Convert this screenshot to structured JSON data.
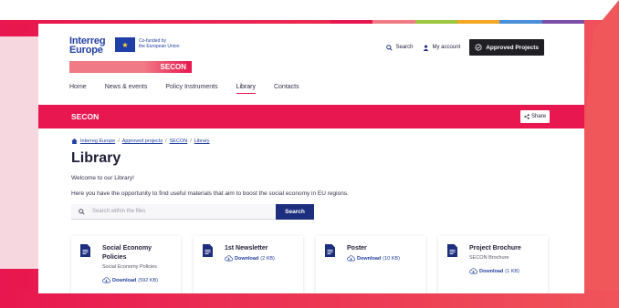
{
  "colors": {
    "brand_red": "#e8174f",
    "navy": "#1d2e7e",
    "link_blue": "#2340a0",
    "strip": [
      "#e8174f",
      "#f07b86",
      "#9bc53d",
      "#f5a623",
      "#4a90d9",
      "#7b4fa8"
    ]
  },
  "logo": {
    "name_line1": "Interreg",
    "name_line2": "Europe",
    "cofund_line1": "Co-funded by",
    "cofund_line2": "the European Union",
    "project": "SECON"
  },
  "header": {
    "search_label": "Search",
    "account_label": "My account",
    "approved_label": "Approved Projects",
    "search_icon": "search-icon",
    "account_icon": "user-icon"
  },
  "nav": [
    {
      "label": "Home",
      "active": false
    },
    {
      "label": "News & events",
      "active": false
    },
    {
      "label": "Policy Instruments",
      "active": false
    },
    {
      "label": "Library",
      "active": true
    },
    {
      "label": "Contacts",
      "active": false
    }
  ],
  "project_bar": {
    "title": "SECON",
    "share_label": "Share"
  },
  "breadcrumb": [
    "Interreg Europe",
    "Approved projects",
    "SECON",
    "Library"
  ],
  "page": {
    "title": "Library",
    "welcome": "Welcome to our Library!",
    "intro": "Here you have the opportunity to find useful materials that aim to boost the social economy in EU regions."
  },
  "search": {
    "placeholder": "Search within the files",
    "button_label": "Search"
  },
  "documents": [
    {
      "title": "Social Economy Policies",
      "subtitle": "Social Economy Policies",
      "download_label": "Download",
      "size": "(592 KB)"
    },
    {
      "title": "1st Newsletter",
      "subtitle": "",
      "download_label": "Download",
      "size": "(2 KB)"
    },
    {
      "title": "Poster",
      "subtitle": "",
      "download_label": "Download",
      "size": "(10 KB)"
    },
    {
      "title": "Project Brochure",
      "subtitle": "SECON Brochure",
      "download_label": "Download",
      "size": "(1 KB)"
    }
  ]
}
